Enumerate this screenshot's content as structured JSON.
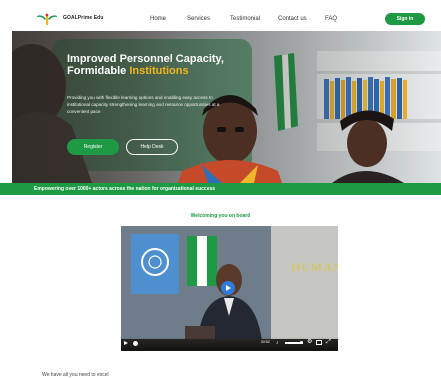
{
  "header": {
    "brand": "GOALPrime Edu",
    "nav": [
      "Home",
      "Services",
      "Testimonial",
      "Contact us",
      "FAQ"
    ],
    "signin_label": "Sign in"
  },
  "hero": {
    "title_line1": "Improved Personnel Capacity,",
    "title_line2_plain": "Formidable ",
    "title_line2_accent": "Institutions",
    "description": "Providing you with flexible learning options and enabling easy access to institutional capacity strengthening learning and resource opportunities at a convenient pace",
    "register_label": "Register",
    "help_label": "Help Desk"
  },
  "banner_text": "Empowering over 1000+ actors across the nation for organizational success",
  "welcome_text": "Welcoming you on board",
  "video": {
    "background_word": "HUMAN",
    "time": "00:52"
  },
  "bottom_text": "We have all you need to excel",
  "colors": {
    "brand_green": "#1e9a45",
    "accent_yellow": "#f4b41a"
  }
}
